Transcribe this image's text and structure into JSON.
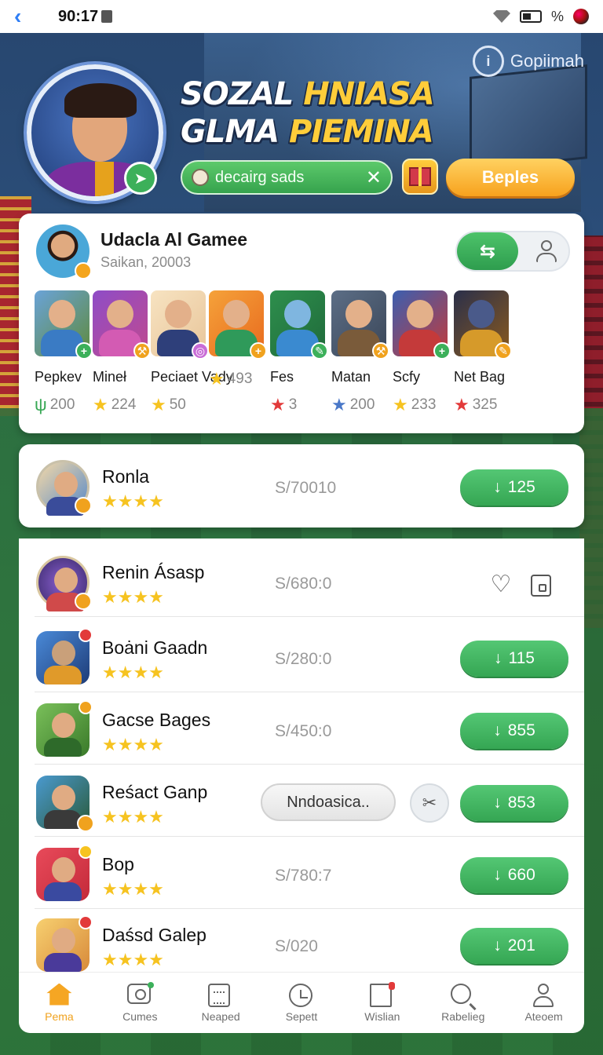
{
  "status_bar": {
    "time": "90:17",
    "battery": "%"
  },
  "header": {
    "help_label": "Gopiimah",
    "title_line1_a": "SOZAL ",
    "title_line1_b": "HNIASA",
    "title_line2_a": "GLMA ",
    "title_line2_b": "PIEMINA",
    "search_value": "decairg sads",
    "orange_button": "Beples"
  },
  "featured": {
    "name": "Udacla Al Gamee",
    "subtitle": "Saikan, 20003",
    "toggle_icon": "swap-icon",
    "players": [
      {
        "name": "Pepkev",
        "score": "200",
        "icon": "cactus"
      },
      {
        "name": "Mineł",
        "score": "224",
        "icon": "star-gold"
      },
      {
        "name": "Peciaet Vady",
        "score": "50",
        "icon": "star-gold"
      },
      {
        "name": "",
        "score": "493",
        "icon": "star-gold"
      },
      {
        "name": "Fes",
        "score": "3",
        "icon": "star-red"
      },
      {
        "name": "Matan",
        "score": "200",
        "icon": "star-blue"
      },
      {
        "name": "Scfy",
        "score": "233",
        "icon": "star-gold"
      },
      {
        "name": "Net Bag",
        "score": "325",
        "icon": "star-red"
      }
    ]
  },
  "items": [
    {
      "title": "Ronla",
      "price": "S/70010",
      "rating": 4,
      "download": "125"
    },
    {
      "title": "Renin Ásasp",
      "price": "S/680:0",
      "rating": 4
    },
    {
      "title": "Boȧni Gaadn",
      "price": "S/280:0",
      "rating": 4,
      "download": "115"
    },
    {
      "title": "Gacse Bages",
      "price": "S/450:0",
      "rating": 4,
      "download": "855"
    },
    {
      "title": "Reśact Ganp",
      "price": "",
      "rating": 4,
      "secondary_button": "Nndoasica..",
      "download": "853"
    },
    {
      "title": "Bop",
      "price": "S/780:7",
      "rating": 4,
      "download": "660"
    },
    {
      "title": "Daśsd Galep",
      "price": "S/020",
      "rating": 4,
      "download": "201"
    }
  ],
  "nav": [
    {
      "label": "Pema",
      "icon": "home-icon",
      "active": true
    },
    {
      "label": "Cumes",
      "icon": "camera-icon"
    },
    {
      "label": "Neaped",
      "icon": "clipboard-icon"
    },
    {
      "label": "Sepett",
      "icon": "clock-icon"
    },
    {
      "label": "Wislian",
      "icon": "board-icon"
    },
    {
      "label": "Rabelieg",
      "icon": "search-icon"
    },
    {
      "label": "Ateoem",
      "icon": "user-icon"
    }
  ],
  "colors": {
    "accent_green": "#35a653",
    "accent_orange": "#f7a21d",
    "star": "#f6c320"
  }
}
